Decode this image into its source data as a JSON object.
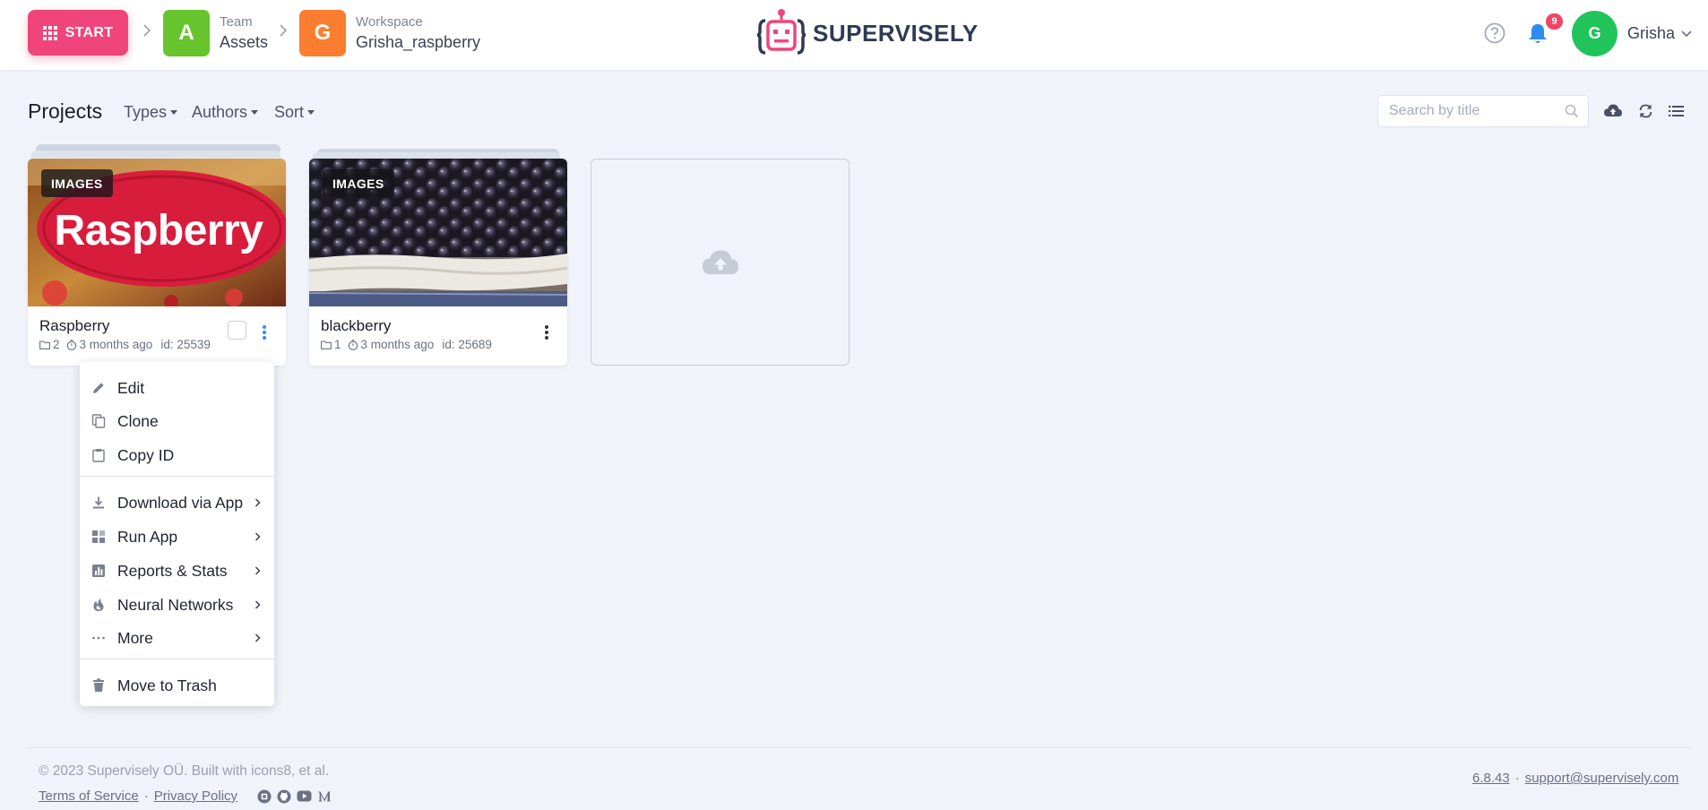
{
  "header": {
    "start_label": "START",
    "team": {
      "initial": "A",
      "caption": "Team",
      "name": "Assets",
      "color": "#68c42c"
    },
    "workspace": {
      "initial": "G",
      "caption": "Workspace",
      "name": "Grisha_raspberry",
      "color": "#fb7d2f"
    },
    "brand": "SUPERVISELY",
    "notifications_count": "9",
    "user": {
      "initial": "G",
      "name": "Grisha"
    },
    "icons": [
      "help-icon",
      "bell-icon",
      "chevron-down-icon"
    ]
  },
  "toolbar": {
    "title": "Projects",
    "filters": [
      "Types",
      "Authors",
      "Sort"
    ],
    "search_placeholder": "Search by title",
    "icons": [
      "upload-cloud-icon",
      "refresh-icon",
      "list-view-icon"
    ]
  },
  "projects": [
    {
      "tag": "IMAGES",
      "name": "Raspberry",
      "datasets": "2",
      "updated": "3 months ago",
      "id": "id: 25539",
      "image": "raspberry-label-photo"
    },
    {
      "tag": "IMAGES",
      "name": "blackberry",
      "datasets": "1",
      "updated": "3 months ago",
      "id": "id: 25689",
      "image": "blackberries-photo"
    }
  ],
  "context_menu": {
    "items": [
      {
        "label": "Edit",
        "icon": "pencil-icon"
      },
      {
        "label": "Clone",
        "icon": "copy-icon"
      },
      {
        "label": "Copy ID",
        "icon": "clipboard-icon"
      },
      {
        "label": "Download via App",
        "icon": "download-icon",
        "submenu": true
      },
      {
        "label": "Run App",
        "icon": "apps-icon",
        "submenu": true
      },
      {
        "label": "Reports & Stats",
        "icon": "chart-icon",
        "submenu": true
      },
      {
        "label": "Neural Networks",
        "icon": "flame-icon",
        "submenu": true
      },
      {
        "label": "More",
        "icon": "ellipsis-icon",
        "submenu": true
      },
      {
        "label": "Move to Trash",
        "icon": "trash-icon"
      }
    ]
  },
  "footer": {
    "copyright": "© 2023 Supervisely OÜ. Built with icons8, et al.",
    "terms": "Terms of Service",
    "privacy": "Privacy Policy",
    "separator": "·",
    "version": "6.8.43",
    "support": "support@supervisely.com",
    "social_icons": [
      "slack-icon",
      "github-icon",
      "youtube-icon",
      "medium-icon"
    ]
  },
  "colors": {
    "accent_pink": "#f0457a",
    "blue_icon": "#2d8cf0",
    "background": "#f0f3f9"
  }
}
